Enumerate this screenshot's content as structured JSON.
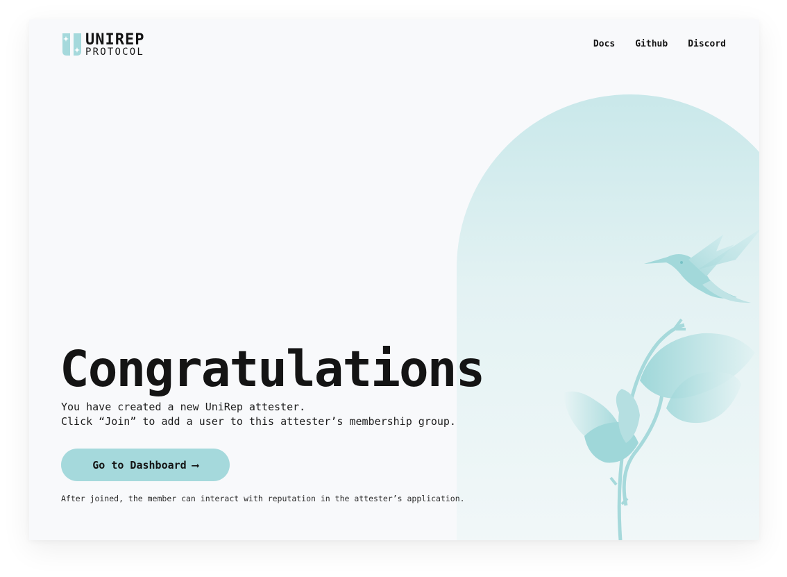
{
  "header": {
    "logo": {
      "title": "UNIREP",
      "subtitle": "PROTOCOL"
    },
    "nav": [
      {
        "label": "Docs"
      },
      {
        "label": "Github"
      },
      {
        "label": "Discord"
      }
    ]
  },
  "hero": {
    "headline": "Congratulations",
    "line1": "You have created a new UniRep attester.",
    "line2": "Click “Join” to add a user to this attester’s membership group.",
    "cta_label": "Go to Dashboard",
    "cta_arrow": "⟶",
    "note": "After joined, the member can interact with reputation in the attester’s application."
  },
  "colors": {
    "accent": "#a5d9dc",
    "arch_top": "#cde9ea",
    "text": "#141414",
    "background": "#f8f9fb"
  },
  "icons": [
    "unirep-logo-icon",
    "hummingbird-illustration",
    "plant-illustration",
    "arrow-right-icon"
  ]
}
